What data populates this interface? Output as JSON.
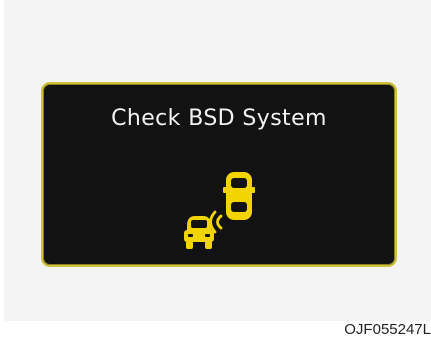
{
  "display": {
    "message": "Check BSD System",
    "icon": "bsd-warning-icon",
    "accent_color": "#f2d400",
    "background_color": "#121212"
  },
  "caption": "OJF055247L"
}
